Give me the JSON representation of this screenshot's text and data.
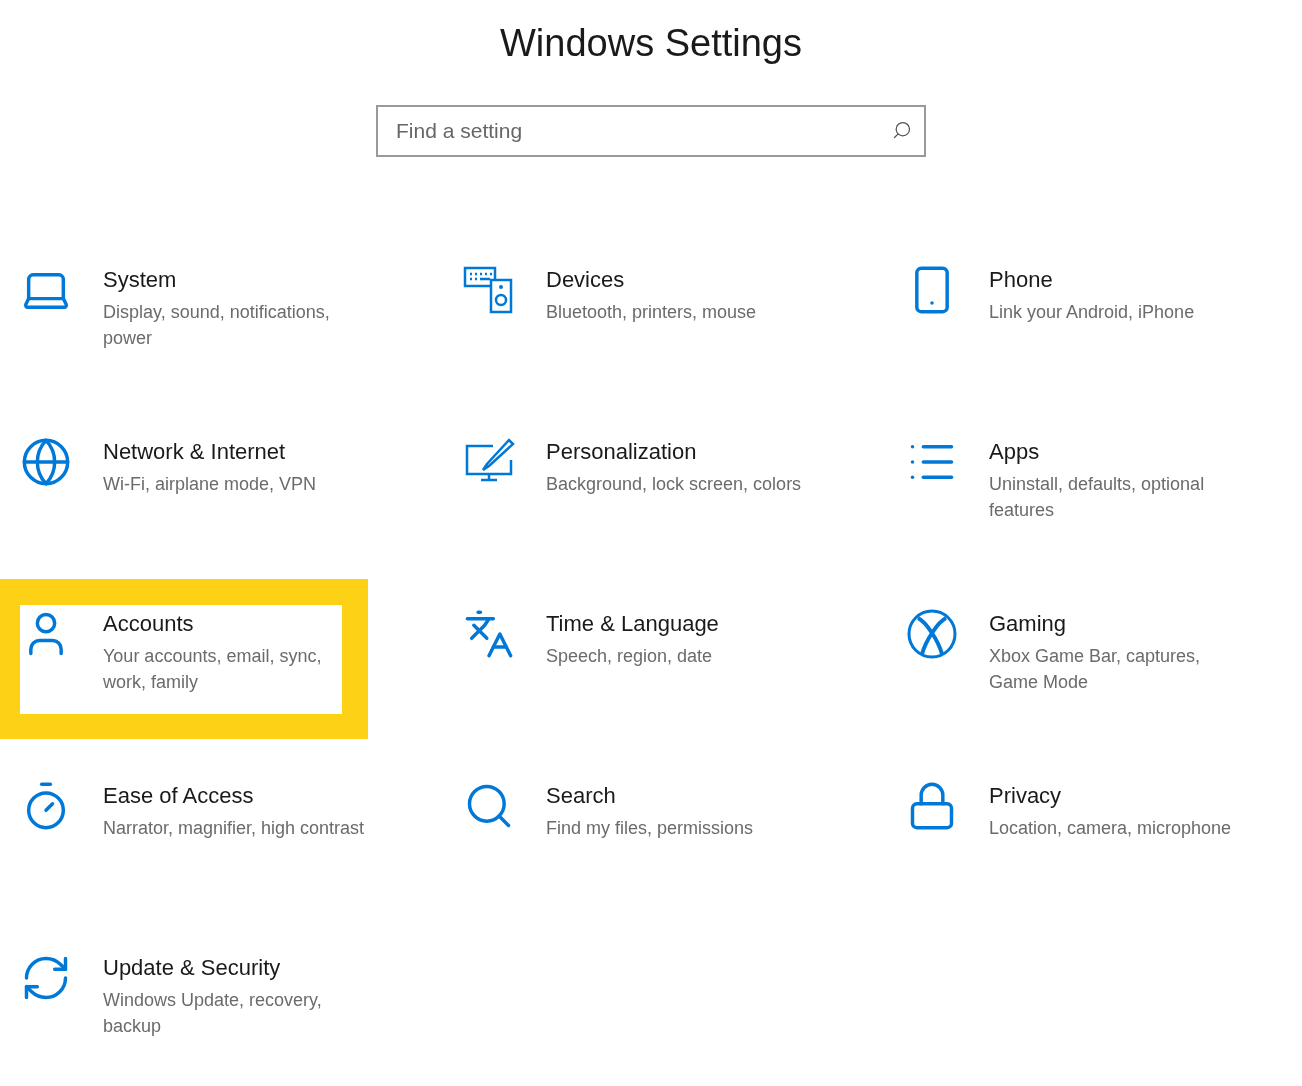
{
  "window": {
    "title": "Windows Settings"
  },
  "search": {
    "placeholder": "Find a setting"
  },
  "categories": [
    {
      "title": "System",
      "description": "Display, sound, notifications, power",
      "highlighted": false
    },
    {
      "title": "Devices",
      "description": "Bluetooth, printers, mouse",
      "highlighted": false
    },
    {
      "title": "Phone",
      "description": "Link your Android, iPhone",
      "highlighted": false
    },
    {
      "title": "Network & Internet",
      "description": "Wi-Fi, airplane mode, VPN",
      "highlighted": false
    },
    {
      "title": "Personalization",
      "description": "Background, lock screen, colors",
      "highlighted": false
    },
    {
      "title": "Apps",
      "description": "Uninstall, defaults, optional features",
      "highlighted": false
    },
    {
      "title": "Accounts",
      "description": "Your accounts, email, sync, work, family",
      "highlighted": true
    },
    {
      "title": "Time & Language",
      "description": "Speech, region, date",
      "highlighted": false
    },
    {
      "title": "Gaming",
      "description": "Xbox Game Bar, captures, Game Mode",
      "highlighted": false
    },
    {
      "title": "Ease of Access",
      "description": "Narrator, magnifier, high contrast",
      "highlighted": false
    },
    {
      "title": "Search",
      "description": "Find my files, permissions",
      "highlighted": false
    },
    {
      "title": "Privacy",
      "description": "Location, camera, microphone",
      "highlighted": false
    },
    {
      "title": "Update & Security",
      "description": "Windows Update, recovery, backup",
      "highlighted": false
    }
  ]
}
